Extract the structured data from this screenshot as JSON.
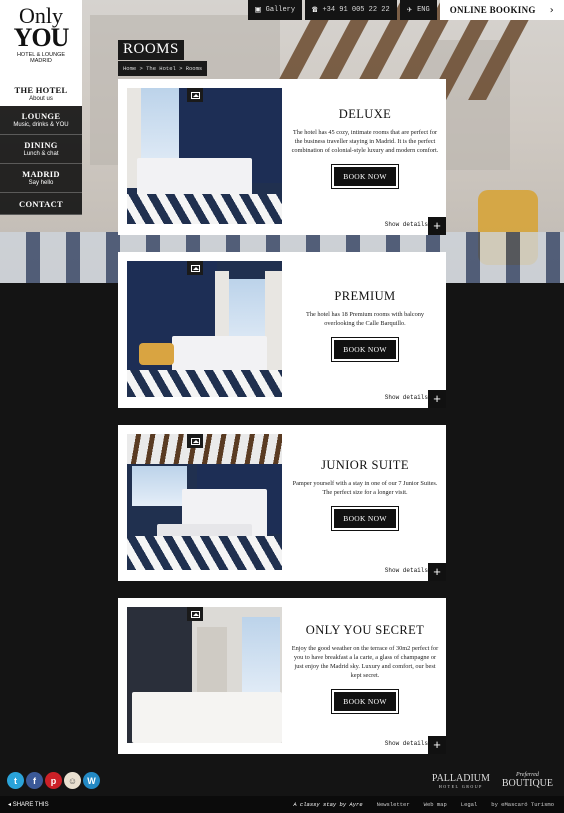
{
  "topbar": {
    "gallery_label": "Gallery",
    "phone": "+34 91 005 22 22",
    "language": "ENG",
    "booking_label": "ONLINE BOOKING"
  },
  "logo": {
    "line1": "Only",
    "line2": "YOU",
    "line3": "HOTEL & LOUNGE",
    "line4": "MADRID"
  },
  "nav": [
    {
      "title": "THE HOTEL",
      "sub": "About us",
      "active": true
    },
    {
      "title": "LOUNGE",
      "sub": "Music, drinks & YOU",
      "active": false
    },
    {
      "title": "DINING",
      "sub": "Lunch & chat",
      "active": false
    },
    {
      "title": "MADRID",
      "sub": "Say hello",
      "active": false
    },
    {
      "title": "CONTACT",
      "sub": "",
      "active": false
    }
  ],
  "page": {
    "title": "ROOMS",
    "breadcrumb": "Home > The Hotel > Rooms"
  },
  "rooms": [
    {
      "title": "DELUXE",
      "description": "The hotel has 45 cozy, intimate rooms that are perfect for the business traveller staying in Madrid. It is the perfect combination of colonial-style luxury and modern comfort.",
      "book_label": "BOOK NOW",
      "details_label": "Show details"
    },
    {
      "title": "PREMIUM",
      "description": "The hotel has 18 Premium rooms with balcony overlooking the Calle Barquillo.",
      "book_label": "BOOK NOW",
      "details_label": "Show details"
    },
    {
      "title": "JUNIOR SUITE",
      "description": "Pamper yourself with a stay in one of our 7 Junior Suites. The perfect size for a longer visit.",
      "book_label": "BOOK NOW",
      "details_label": "Show details"
    },
    {
      "title": "ONLY YOU SECRET",
      "description": "Enjoy the good weather on the terrace of 30m2 perfect for you to have breakfast a la carte, a glass of champagne or just enjoy the Madrid sky. Luxury and comfort, our best kept secret.",
      "book_label": "BOOK NOW",
      "details_label": "Show details"
    }
  ],
  "social": [
    {
      "icon": "twitter-icon",
      "glyph": "t",
      "color": "#2aa3d9"
    },
    {
      "icon": "facebook-icon",
      "glyph": "f",
      "color": "#3b5998"
    },
    {
      "icon": "pinterest-icon",
      "glyph": "p",
      "color": "#cb2027"
    },
    {
      "icon": "foursquare-icon",
      "glyph": "☺",
      "color": "#e9e0d0"
    },
    {
      "icon": "wordpress-icon",
      "glyph": "W",
      "color": "#2389c4"
    }
  ],
  "partners": {
    "palladium": "PALLADIUM",
    "palladium_sub": "HOTEL GROUP",
    "boutique_small": "Preferred",
    "boutique": "BOUTIQUE"
  },
  "footer": {
    "share_label": "SHARE THIS",
    "tagline": "A classy stay by Ayre",
    "newsletter": "Newsletter",
    "webmap": "Web map",
    "legal": "Legal",
    "credit": "by eMascaró Turismo"
  },
  "colors": {
    "accent_dark": "#111111",
    "navy": "#1d2e55",
    "gold": "#d6a43a"
  }
}
